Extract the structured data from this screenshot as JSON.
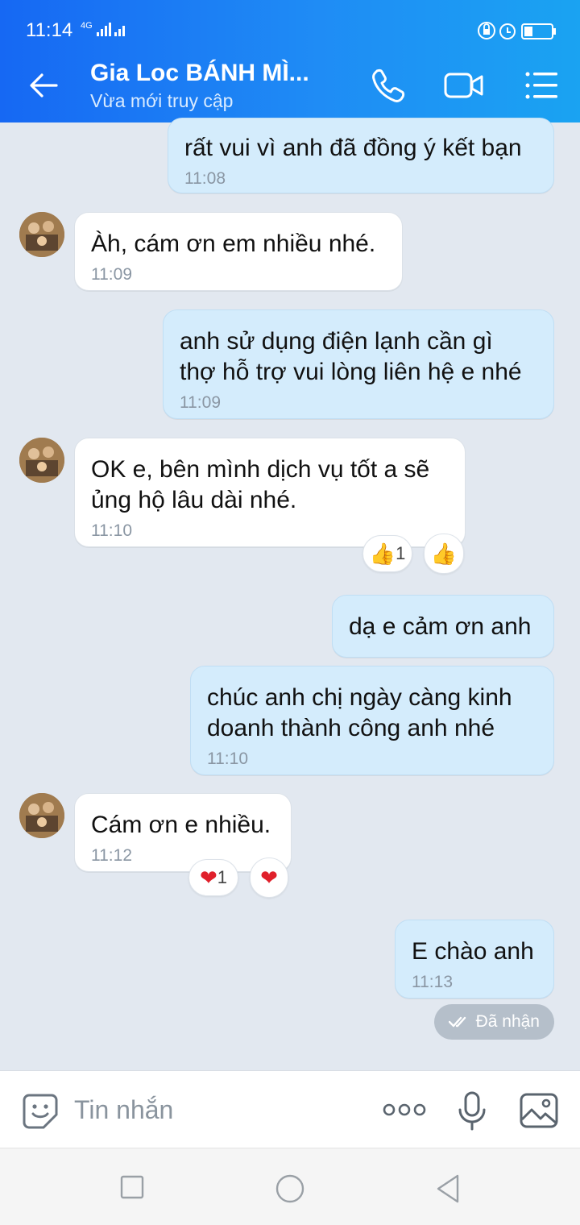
{
  "status_bar": {
    "time": "11:14",
    "network": "4G"
  },
  "header": {
    "title": "Gia Loc BÁNH MÌ...",
    "subtitle": "Vừa mới truy cập",
    "icons": [
      "back-arrow-icon",
      "phone-icon",
      "video-call-icon",
      "menu-list-icon"
    ]
  },
  "messages": [
    {
      "side": "sent",
      "text": "rất vui vì anh đã đồng ý kết bạn",
      "time": "11:08"
    },
    {
      "side": "received",
      "text": "Àh, cám ơn em nhiều nhé.",
      "time": "11:09"
    },
    {
      "side": "sent",
      "lines": [
        "anh sử dụng điện lạnh cần gì",
        "thợ hỗ trợ vui lòng liên hệ e nhé"
      ],
      "time": "11:09"
    },
    {
      "side": "received",
      "lines": [
        "OK e, bên mình dịch vụ tốt a sẽ",
        "ủng hộ lâu dài nhé."
      ],
      "time": "11:10",
      "reactions": {
        "summary_count": "1",
        "summary_icon": "thumbs-up-icon",
        "add_icon": "thumbs-up-icon"
      }
    },
    {
      "side": "sent",
      "text": "dạ e cảm ơn anh"
    },
    {
      "side": "sent",
      "lines": [
        "chúc anh chị ngày càng kinh",
        "doanh thành công anh nhé"
      ],
      "time": "11:10"
    },
    {
      "side": "received",
      "text": "Cám ơn e nhiều.",
      "time": "11:12",
      "reactions": {
        "summary_count": "1",
        "summary_icon": "heart-icon",
        "add_icon": "heart-icon"
      }
    },
    {
      "side": "sent",
      "text": "E chào anh",
      "time": "11:13"
    }
  ],
  "delivery_status": "Đã nhận",
  "composer": {
    "placeholder": "Tin nhắn"
  },
  "colors": {
    "header": "#1a7ff4",
    "sent_bubble": "#d4ecfc",
    "received_bubble": "#ffffff",
    "background": "#e2e8f0"
  }
}
